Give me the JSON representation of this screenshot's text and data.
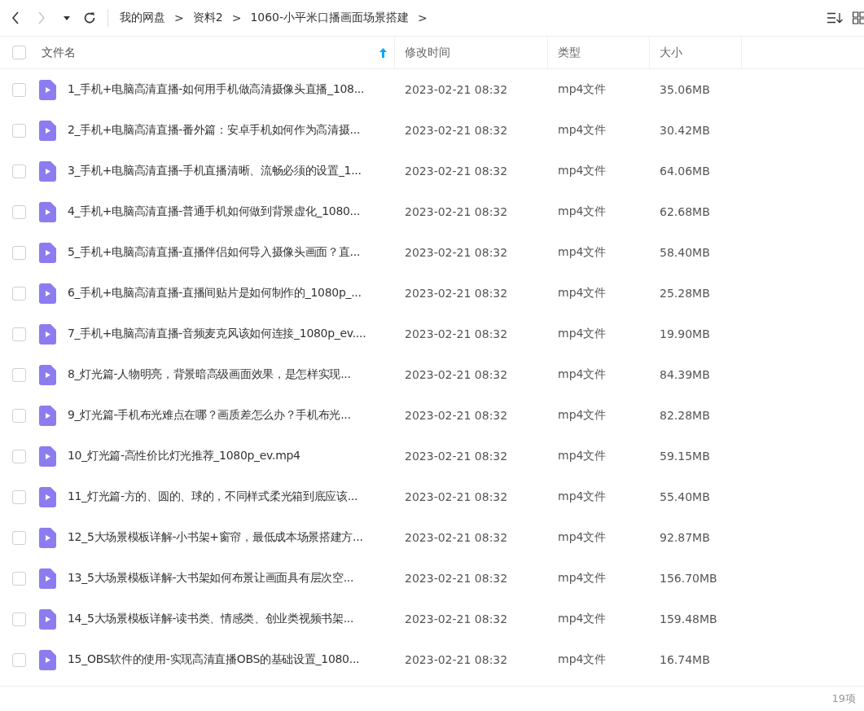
{
  "toolbar": {
    "breadcrumb": [
      {
        "kind": "crumb",
        "label": "我的网盘"
      },
      {
        "kind": "sep",
        "label": ">"
      },
      {
        "kind": "crumb",
        "label": "资料2"
      },
      {
        "kind": "sep",
        "label": ">"
      },
      {
        "kind": "crumb",
        "label": "1060-小平米口播画面场景搭建"
      },
      {
        "kind": "sep",
        "label": ">"
      }
    ],
    "back_disabled": false,
    "forward_disabled": true
  },
  "table": {
    "select_all": {
      "checked": false
    },
    "columns": [
      {
        "label": "文件名",
        "sorted": true
      },
      {
        "label": "修改时间",
        "sorted": false
      },
      {
        "label": "类型",
        "sorted": false
      },
      {
        "label": "大小",
        "sorted": false
      }
    ],
    "rows": [
      {
        "checked": false,
        "name": "1_手机+电脑高清直播-如何用手机做高清摄像头直播_108...",
        "modified": "2023-02-21 08:32",
        "type": "mp4文件",
        "size": "35.06MB"
      },
      {
        "checked": false,
        "name": "2_手机+电脑高清直播-番外篇：安卓手机如何作为高清摄...",
        "modified": "2023-02-21 08:32",
        "type": "mp4文件",
        "size": "30.42MB"
      },
      {
        "checked": false,
        "name": "3_手机+电脑高清直播-手机直播清晰、流畅必须的设置_1...",
        "modified": "2023-02-21 08:32",
        "type": "mp4文件",
        "size": "64.06MB"
      },
      {
        "checked": false,
        "name": "4_手机+电脑高清直播-普通手机如何做到背景虚化_1080...",
        "modified": "2023-02-21 08:32",
        "type": "mp4文件",
        "size": "62.68MB"
      },
      {
        "checked": false,
        "name": "5_手机+电脑高清直播-直播伴侣如何导入摄像头画面？直...",
        "modified": "2023-02-21 08:32",
        "type": "mp4文件",
        "size": "58.40MB"
      },
      {
        "checked": false,
        "name": "6_手机+电脑高清直播-直播间贴片是如何制作的_1080p_...",
        "modified": "2023-02-21 08:32",
        "type": "mp4文件",
        "size": "25.28MB"
      },
      {
        "checked": false,
        "name": "7_手机+电脑高清直播-音频麦克风该如何连接_1080p_ev....",
        "modified": "2023-02-21 08:32",
        "type": "mp4文件",
        "size": "19.90MB"
      },
      {
        "checked": false,
        "name": "8_灯光篇-人物明亮，背景暗高级画面效果，是怎样实现...",
        "modified": "2023-02-21 08:32",
        "type": "mp4文件",
        "size": "84.39MB"
      },
      {
        "checked": false,
        "name": "9_灯光篇-手机布光难点在哪？画质差怎么办？手机布光...",
        "modified": "2023-02-21 08:32",
        "type": "mp4文件",
        "size": "82.28MB"
      },
      {
        "checked": false,
        "name": "10_灯光篇-高性价比灯光推荐_1080p_ev.mp4",
        "modified": "2023-02-21 08:32",
        "type": "mp4文件",
        "size": "59.15MB"
      },
      {
        "checked": false,
        "name": "11_灯光篇-方的、圆的、球的，不同样式柔光箱到底应该...",
        "modified": "2023-02-21 08:32",
        "type": "mp4文件",
        "size": "55.40MB"
      },
      {
        "checked": false,
        "name": "12_5大场景模板详解-小书架+窗帘，最低成本场景搭建方...",
        "modified": "2023-02-21 08:32",
        "type": "mp4文件",
        "size": "92.87MB"
      },
      {
        "checked": false,
        "name": "13_5大场景模板详解-大书架如何布景让画面具有层次空...",
        "modified": "2023-02-21 08:32",
        "type": "mp4文件",
        "size": "156.70MB"
      },
      {
        "checked": false,
        "name": "14_5大场景模板详解-读书类、情感类、创业类视频书架...",
        "modified": "2023-02-21 08:32",
        "type": "mp4文件",
        "size": "159.48MB"
      },
      {
        "checked": false,
        "name": "15_OBS软件的使用-实现高清直播OBS的基础设置_1080...",
        "modified": "2023-02-21 08:32",
        "type": "mp4文件",
        "size": "16.74MB"
      }
    ]
  },
  "status_bar": {
    "count": "19项"
  }
}
